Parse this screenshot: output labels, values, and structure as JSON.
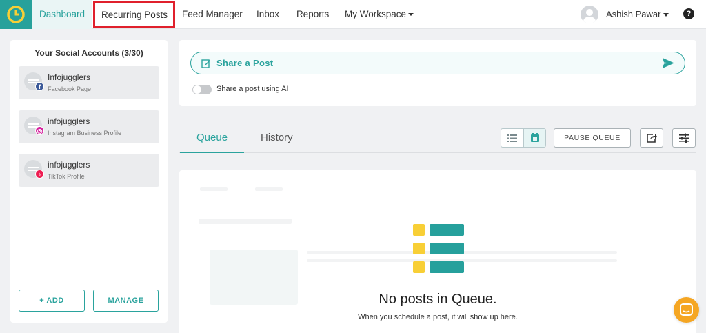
{
  "nav": {
    "items": [
      {
        "label": "Dashboard"
      },
      {
        "label": "Recurring Posts"
      },
      {
        "label": "Feed Manager"
      },
      {
        "label": "Inbox"
      },
      {
        "label": "Reports"
      },
      {
        "label": "My Workspace"
      }
    ],
    "user_name": "Ashish Pawar",
    "help": "?"
  },
  "accounts_panel": {
    "title": "Your Social Accounts (3/30)",
    "accounts": [
      {
        "name": "Infojugglers",
        "type": "Facebook Page",
        "network_icon": "facebook-icon",
        "badge": "f",
        "color": "#3b5998"
      },
      {
        "name": "infojugglers",
        "type": "Instagram Business Profile",
        "network_icon": "instagram-icon",
        "badge": "◎",
        "color": "#d6249f"
      },
      {
        "name": "infojugglers",
        "type": "TikTok Profile",
        "network_icon": "tiktok-icon",
        "badge": "♪",
        "color": "#ee1d52"
      }
    ],
    "add_label": "+ ADD",
    "manage_label": "MANAGE"
  },
  "share": {
    "label": "Share a Post",
    "ai_toggle_label": "Share a post using AI",
    "ai_toggle_on": false
  },
  "tabs": {
    "queue": "Queue",
    "history": "History",
    "active": "queue"
  },
  "toolbar": {
    "pause_label": "PAUSE QUEUE",
    "view_mode": "calendar"
  },
  "queue": {
    "empty_title": "No posts in Queue.",
    "empty_subtitle": "When you schedule a post, it will show up here."
  },
  "colors": {
    "accent": "#2aa39d",
    "highlight_box": "#e0202c",
    "chat_button": "#f5a623"
  }
}
